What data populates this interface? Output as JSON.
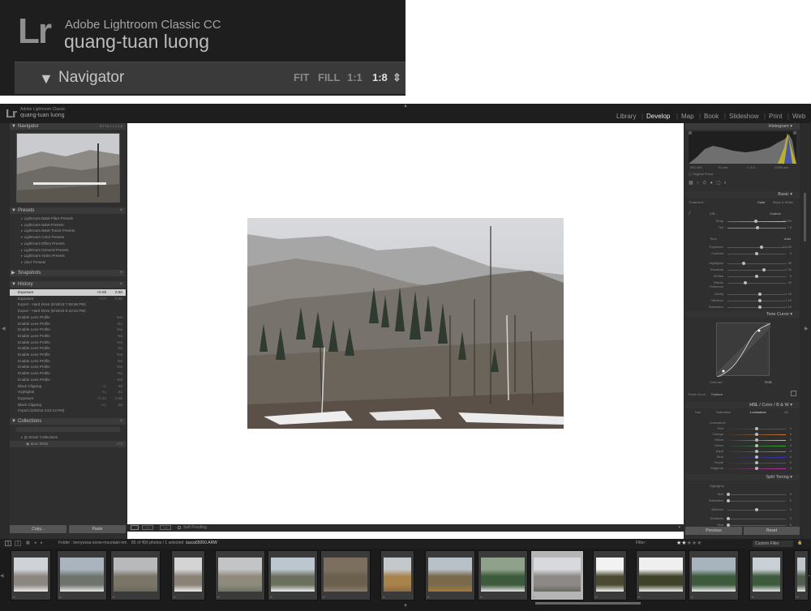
{
  "zoom": {
    "app_name": "Adobe Lightroom Classic CC",
    "user": "quang-tuan luong",
    "navigator": "Navigator",
    "zoom_options": [
      "FIT",
      "FILL",
      "1:1",
      "1:8"
    ],
    "zoom_selected": "1:8"
  },
  "app": {
    "logo": "Lr",
    "app_name": "Adobe Lightroom Classic",
    "user": "quang-tuan luong",
    "modules": [
      "Library",
      "Develop",
      "Map",
      "Book",
      "Slideshow",
      "Print",
      "Web"
    ],
    "active_module": "Develop"
  },
  "left": {
    "navigator": {
      "title": "Navigator",
      "zoom": [
        "FIT",
        "FILL",
        "1:1",
        "1:8"
      ]
    },
    "presets": {
      "title": "Presets",
      "items": [
        "Lightroom B&W Filter Presets",
        "Lightroom B&W Presets",
        "Lightroom B&W Toned Presets",
        "Lightroom Color Presets",
        "Lightroom Effect Presets",
        "Lightroom General Presets",
        "Lightroom Video Presets",
        "User Presets"
      ]
    },
    "snapshots": {
      "title": "Snapshots"
    },
    "history": {
      "title": "History",
      "items": [
        {
          "label": "Exposure",
          "v1": "+0.05",
          "v2": "0.50"
        },
        {
          "label": "Exposure",
          "v1": "+0.5",
          "v2": "0.45"
        },
        {
          "label": "Export - Hard Drive (5/18/18 7:58:56 PM)",
          "v1": "",
          "v2": ""
        },
        {
          "label": "Export - Hard Drive (5/15/18 8:40:43 PM)",
          "v1": "",
          "v2": ""
        },
        {
          "label": "Enable Lens Profile",
          "v1": "",
          "v2": "Yes"
        },
        {
          "label": "Enable Lens Profile",
          "v1": "",
          "v2": "No"
        },
        {
          "label": "Enable Lens Profile",
          "v1": "",
          "v2": "Yes"
        },
        {
          "label": "Enable Lens Profile",
          "v1": "",
          "v2": "No"
        },
        {
          "label": "Enable Lens Profile",
          "v1": "",
          "v2": "Yes"
        },
        {
          "label": "Enable Lens Profile",
          "v1": "",
          "v2": "No"
        },
        {
          "label": "Enable Lens Profile",
          "v1": "",
          "v2": "Yes"
        },
        {
          "label": "Enable Lens Profile",
          "v1": "",
          "v2": "No"
        },
        {
          "label": "Enable Lens Profile",
          "v1": "",
          "v2": "Yes"
        },
        {
          "label": "Enable Lens Profile",
          "v1": "",
          "v2": "No"
        },
        {
          "label": "Enable Lens Profile",
          "v1": "",
          "v2": "Yes"
        },
        {
          "label": "Black Clipping",
          "v1": "+1",
          "v2": "-40"
        },
        {
          "label": "Highlights",
          "v1": "-41",
          "v2": "-41"
        },
        {
          "label": "Exposure",
          "v1": "+0.30",
          "v2": "0.30"
        },
        {
          "label": "Black Clipping",
          "v1": "+11",
          "v2": "-33"
        },
        {
          "label": "Import (4/28/18 4:53:13 PM)",
          "v1": "",
          "v2": ""
        }
      ]
    },
    "collections": {
      "title": "Collections",
      "items": [
        "Smart Collections",
        "dcec-2015"
      ],
      "count": "173"
    },
    "copy": "Copy...",
    "paste": "Paste"
  },
  "toolbar": {
    "soft_proofing": "Soft Proofing"
  },
  "right": {
    "histogram": "Histogram",
    "exif": [
      "ISO 200",
      "70 mm",
      "f / 6.3",
      "1/250 sec"
    ],
    "original_photo": "Original Photo",
    "basic": "Basic",
    "treatment": "Treatment :",
    "color": "Color",
    "bw": "Black & White",
    "wb": "WB :",
    "wb_value": "Custom",
    "tone": "Tone",
    "auto": "Auto",
    "presence": "Presence",
    "basic_sliders": [
      {
        "label": "Temp",
        "value": "5,000",
        "pos": 0.48
      },
      {
        "label": "Tint",
        "value": "+ 8",
        "pos": 0.52
      },
      {
        "label": "Exposure",
        "value": "+ 0.50",
        "pos": 0.58
      },
      {
        "label": "Contrast",
        "value": "0",
        "pos": 0.5
      },
      {
        "label": "Highlights",
        "value": "- 45",
        "pos": 0.28
      },
      {
        "label": "Shadows",
        "value": "+ 26",
        "pos": 0.63
      },
      {
        "label": "Whites",
        "value": "0",
        "pos": 0.5
      },
      {
        "label": "Blacks",
        "value": "- 40",
        "pos": 0.3
      },
      {
        "label": "Clarity",
        "value": "+ 10",
        "pos": 0.55
      },
      {
        "label": "Vibrance",
        "value": "+ 10",
        "pos": 0.55
      },
      {
        "label": "Saturation",
        "value": "+ 10",
        "pos": 0.55
      }
    ],
    "tone_curve": "Tone Curve",
    "channel": "Channel :",
    "channel_value": "RGB",
    "point_curve": "Point Curve :",
    "point_curve_value": "Custom",
    "hsl": "HSL",
    "hsl_tabs": [
      "HSL",
      "/",
      "Color",
      "/",
      "B & W"
    ],
    "hsl_sub": [
      "Hue",
      "Saturation",
      "Luminance",
      "All"
    ],
    "luminance": "Luminance",
    "hsl_colors": [
      "Red",
      "Orange",
      "Yellow",
      "Green",
      "Aqua",
      "Blue",
      "Purple",
      "Magenta"
    ],
    "hsl_values": [
      "0",
      "0",
      "0",
      "0",
      "0",
      "0",
      "0",
      "0"
    ],
    "split_toning": "Split Toning",
    "split_highlights": "Highlights",
    "split_items": [
      "Hue",
      "Saturation",
      "Balance",
      "Shadows",
      "Hue"
    ],
    "split_values": [
      "0",
      "0",
      "0",
      "0",
      "0"
    ],
    "previous": "Previous",
    "reset": "Reset"
  },
  "filmstrip": {
    "page_indicators": [
      "1",
      "2"
    ],
    "folder": "Folder : berryessa-snow-mountain-nm",
    "count": "85 of 456 photos / 1 selected",
    "filename": "/usca65050.ARW",
    "filter": "Filter :",
    "custom_filter": "Custom Filter",
    "rating": "★★★★★",
    "rating_value": 2
  }
}
